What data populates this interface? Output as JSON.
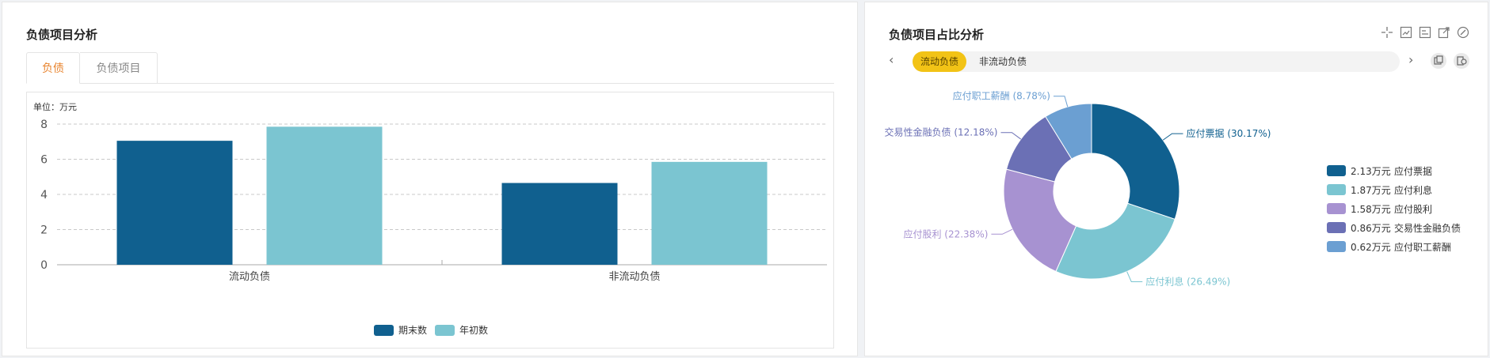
{
  "left": {
    "title": "负债项目分析",
    "tabs": [
      {
        "label": "负债",
        "active": true
      },
      {
        "label": "负债项目",
        "active": false
      }
    ]
  },
  "right": {
    "title": "负债项目占比分析",
    "segments": [
      {
        "label": "流动负债",
        "active": true
      },
      {
        "label": "非流动负债",
        "active": false
      }
    ],
    "icons": [
      "restore-icon",
      "zoom-icon",
      "zoom-reset-icon",
      "save-image-icon",
      "settings-icon",
      "data-view-icon",
      "chart-switch-icon"
    ]
  },
  "chart_data": [
    {
      "type": "bar",
      "unit_label": "单位：万元",
      "categories": [
        "流动负债",
        "非流动负债"
      ],
      "series": [
        {
          "name": "期末数",
          "values": [
            7.05,
            4.65
          ],
          "color": "#10608f"
        },
        {
          "name": "年初数",
          "values": [
            7.85,
            5.85
          ],
          "color": "#7bc5d1"
        }
      ],
      "ylim": [
        0,
        8
      ],
      "yticks": [
        0,
        2,
        4,
        6,
        8
      ],
      "grid": true,
      "legend": "bottom"
    },
    {
      "type": "pie",
      "subtype": "donut",
      "slices": [
        {
          "name": "应付票据",
          "value": 2.13,
          "percent": 30.17,
          "legend_text": "2.13万元",
          "label": "应付票据 (30.17%)",
          "color": "#10608f"
        },
        {
          "name": "应付利息",
          "value": 1.87,
          "percent": 26.49,
          "legend_text": "1.87万元",
          "label": "应付利息 (26.49%)",
          "color": "#7bc5d1"
        },
        {
          "name": "应付股利",
          "value": 1.58,
          "percent": 22.38,
          "legend_text": "1.58万元",
          "label": "应付股利 (22.38%)",
          "color": "#a792d1"
        },
        {
          "name": "交易性金融负债",
          "value": 0.86,
          "percent": 12.18,
          "legend_text": "0.86万元",
          "label": "交易性金融负债 (12.18%)",
          "color": "#6b70b5"
        },
        {
          "name": "应付职工薪酬",
          "value": 0.62,
          "percent": 8.78,
          "legend_text": "0.62万元",
          "label": "应付职工薪酬 (8.78%)",
          "color": "#6b9fd2"
        }
      ],
      "legend": "right"
    }
  ]
}
